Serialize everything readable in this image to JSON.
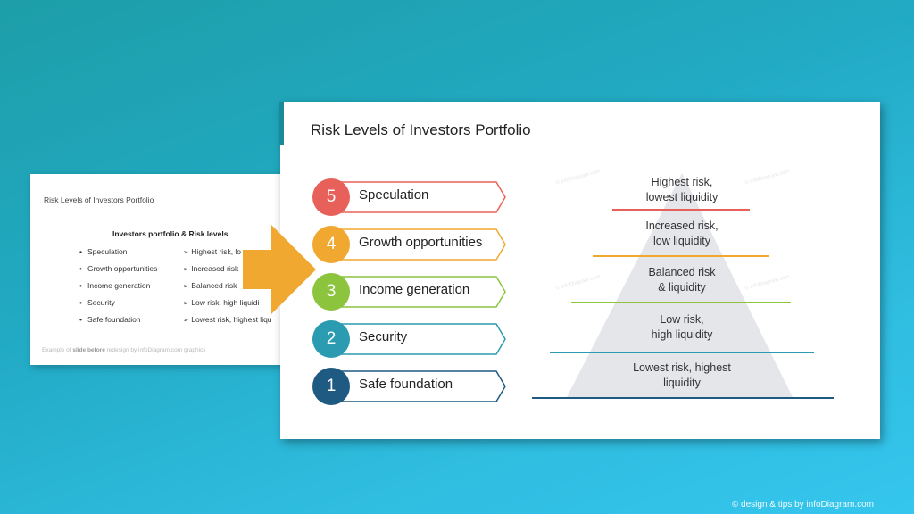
{
  "before_slide": {
    "title": "Risk Levels of Investors Portfolio",
    "subtitle": "Investors portfolio & Risk levels",
    "bullets": [
      "Speculation",
      "Growth opportunities",
      "Income generation",
      "Security",
      "Safe foundation"
    ],
    "descriptions": [
      "Highest risk, lo",
      "Increased risk",
      "Balanced risk",
      "Low risk, high liquidi",
      "Lowest risk, highest liqu"
    ],
    "footer_prefix": "Example of ",
    "footer_bold": "slide before",
    "footer_suffix": " redesign by infoDiagram.com graphics"
  },
  "arrow": {
    "icon": "arrow-right-icon",
    "color": "#f0a830"
  },
  "after_slide": {
    "title": "Risk Levels of Investors Portfolio",
    "levels": [
      {
        "number": "5",
        "label": "Speculation",
        "color": "#e8605a"
      },
      {
        "number": "4",
        "label": "Growth opportunities",
        "color": "#f0a830"
      },
      {
        "number": "3",
        "label": "Income generation",
        "color": "#8cc43e"
      },
      {
        "number": "2",
        "label": "Security",
        "color": "#2a9bb0"
      },
      {
        "number": "1",
        "label": "Safe foundation",
        "color": "#1f5a82"
      }
    ],
    "pyramid": [
      {
        "line1": "Highest risk,",
        "line2": "lowest liquidity",
        "color": "#e8605a"
      },
      {
        "line1": "Increased risk,",
        "line2": "low liquidity",
        "color": "#f0a830"
      },
      {
        "line1": "Balanced risk",
        "line2": "& liquidity",
        "color": "#8cc43e"
      },
      {
        "line1": "Low risk,",
        "line2": "high liquidity",
        "color": "#2a9bb0"
      },
      {
        "line1": "Lowest risk, highest",
        "line2": "liquidity",
        "color": "#1f5a82"
      }
    ],
    "watermark": "© infoDiagram.com"
  },
  "credit": "© design & tips by infoDiagram.com"
}
